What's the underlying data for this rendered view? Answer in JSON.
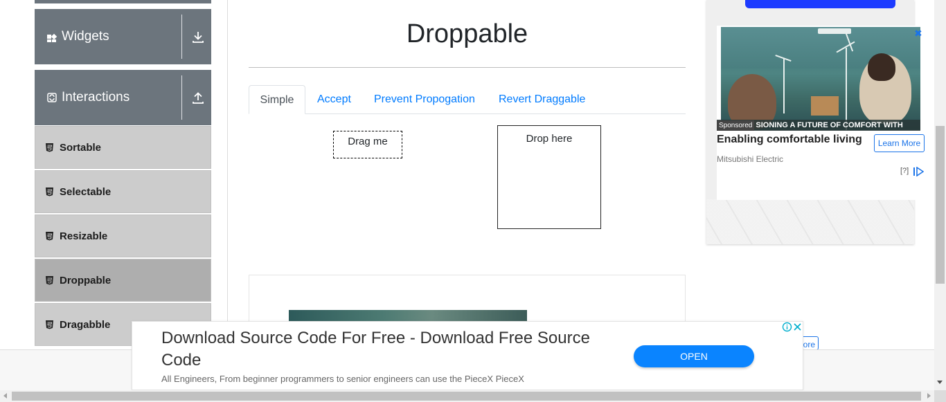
{
  "sidebar": {
    "groups": [
      {
        "label": "Widgets",
        "icon": "widgets-icon",
        "toggle": "download-arrow-icon"
      },
      {
        "label": "Interactions",
        "icon": "interactions-icon",
        "toggle": "upload-arrow-icon"
      }
    ],
    "items": [
      {
        "label": "Sortable",
        "icon": "html5-icon",
        "active": false
      },
      {
        "label": "Selectable",
        "icon": "html5-icon",
        "active": false
      },
      {
        "label": "Resizable",
        "icon": "html5-icon",
        "active": false
      },
      {
        "label": "Droppable",
        "icon": "html5-icon",
        "active": true
      },
      {
        "label": "Dragabble",
        "icon": "html5-icon",
        "active": false
      }
    ]
  },
  "main": {
    "title": "Droppable",
    "tabs": [
      {
        "label": "Simple",
        "active": true
      },
      {
        "label": "Accept",
        "active": false
      },
      {
        "label": "Prevent Propogation",
        "active": false
      },
      {
        "label": "Revert Draggable",
        "active": false
      }
    ],
    "draggable_label": "Drag me",
    "droppable_label": "Drop here"
  },
  "side_ad": {
    "sponsored_label": "Sponsored",
    "caption": "SIONING A FUTURE OF COMFORT WITH",
    "headline": "Enabling comfortable living",
    "cta": "Learn More",
    "advertiser": "Mitsubishi Electric",
    "ad_choices": "[?]",
    "close_glyph": "✖",
    "more_fragment": "ore"
  },
  "banner_ad": {
    "title": "Download Source Code For Free - Download Free Source Code",
    "description": "All Engineers, From beginner programmers to senior engineers can use the PieceX PieceX",
    "cta": "OPEN"
  },
  "colors": {
    "sidebar_header": "#6c757d",
    "sidebar_item": "#cccccc",
    "sidebar_item_active": "#aeaeae",
    "link": "#007bff",
    "banner_button": "#0a84ff"
  }
}
